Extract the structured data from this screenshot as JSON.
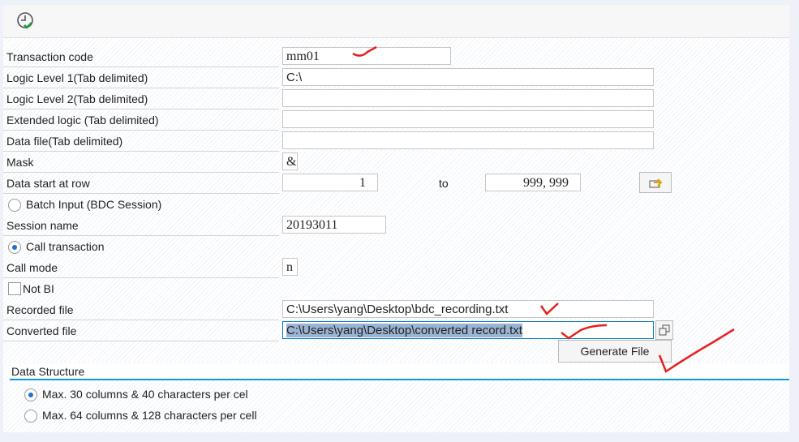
{
  "toolbar": {
    "execute_icon": "clock-check-icon"
  },
  "fields": {
    "transaction_code": {
      "label": "Transaction code",
      "value": "mm01"
    },
    "logic1": {
      "label": "Logic Level 1(Tab delimited)",
      "value": "C:\\"
    },
    "logic2": {
      "label": "Logic Level 2(Tab delimited)",
      "value": ""
    },
    "extended": {
      "label": "Extended logic (Tab delimited)",
      "value": ""
    },
    "datafile": {
      "label": "Data file(Tab delimited)",
      "value": ""
    },
    "mask": {
      "label": "Mask",
      "value": "&"
    },
    "start": {
      "label": "Data start at row",
      "value": "1",
      "to_label": "to",
      "to_value": "999, 999"
    },
    "batch": {
      "label": "Batch Input (BDC Session)",
      "selected": false
    },
    "session": {
      "label": "Session name",
      "value": "20193011"
    },
    "call": {
      "label": "Call transaction",
      "selected": true
    },
    "callmode": {
      "label": "Call mode",
      "value": "n"
    },
    "notbi": {
      "label": "Not BI",
      "checked": false
    },
    "recorded": {
      "label": "Recorded file",
      "value": "C:\\Users\\yang\\Desktop\\bdc_recording.txt"
    },
    "converted": {
      "label": "Converted file",
      "value": "C:\\Users\\yang\\Desktop\\converted record.txt"
    }
  },
  "generate_label": "Generate File",
  "data_structure": {
    "title": "Data Structure",
    "options": [
      {
        "label": "Max. 30 columns & 40 characters per cel",
        "selected": true
      },
      {
        "label": "Max. 64 columns & 128 characters per cell",
        "selected": false
      }
    ]
  },
  "colors": {
    "accent": "#0a9bd7",
    "annotation": "#e8201f"
  }
}
